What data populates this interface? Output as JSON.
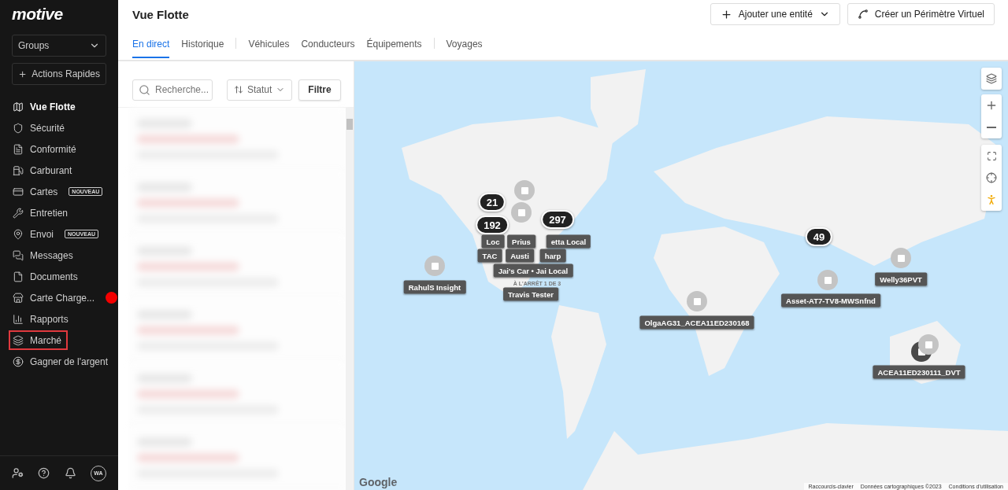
{
  "brand": "motive",
  "sidebar": {
    "groups_select": "Groups",
    "quick_action": "Actions Rapides",
    "items": [
      {
        "label": "Vue Flotte",
        "selected": true,
        "highlighted": false,
        "notification": false
      },
      {
        "label": "Sécurité",
        "selected": false,
        "highlighted": false,
        "notification": false
      },
      {
        "label": "Conformité",
        "selected": false,
        "highlighted": false,
        "notification": false
      },
      {
        "label": "Carburant",
        "selected": false,
        "highlighted": false,
        "notification": false
      },
      {
        "label": "Cartes",
        "badge": "NOUVEAU",
        "selected": false,
        "highlighted": false,
        "notification": false
      },
      {
        "label": "Entretien",
        "selected": false,
        "highlighted": false,
        "notification": false
      },
      {
        "label": "Envoi",
        "badge": "NOUVEAU",
        "selected": false,
        "highlighted": false,
        "notification": false
      },
      {
        "label": "Messages",
        "selected": false,
        "highlighted": false,
        "notification": false
      },
      {
        "label": "Documents",
        "selected": false,
        "highlighted": false,
        "notification": false
      },
      {
        "label": "Carte Charge...",
        "selected": false,
        "highlighted": false,
        "notification": true
      },
      {
        "label": "Rapports",
        "selected": false,
        "highlighted": false,
        "notification": false
      },
      {
        "label": "Marché",
        "selected": false,
        "highlighted": true,
        "notification": false
      },
      {
        "label": "Gagner de l'argent",
        "selected": false,
        "highlighted": false,
        "notification": false
      }
    ],
    "avatar": "WA"
  },
  "header": {
    "title": "Vue Flotte",
    "actions": [
      {
        "label": "Ajouter une entité",
        "kind": "dropdown"
      },
      {
        "label": "Créer un Périmètre Virtuel",
        "kind": "geofence"
      }
    ]
  },
  "tab_groups": [
    {
      "tabs": [
        {
          "label": "En direct",
          "selected": true
        },
        {
          "label": "Historique",
          "selected": false
        }
      ]
    },
    {
      "tabs": [
        {
          "label": "Véhicules",
          "selected": false
        },
        {
          "label": "Conducteurs",
          "selected": false
        },
        {
          "label": "Équipements",
          "selected": false
        }
      ]
    },
    {
      "tabs": [
        {
          "label": "Voyages",
          "selected": false
        }
      ]
    }
  ],
  "list_panel": {
    "search_placeholder": "Recherche...",
    "sort": "Statut",
    "filter": "Filtre"
  },
  "map": {
    "clusters": [
      {
        "count": "21"
      },
      {
        "count": "192"
      },
      {
        "count": "297"
      },
      {
        "count": "49"
      }
    ],
    "labels": [
      {
        "text": "RahulS Insight",
        "kind": "name"
      },
      {
        "text": "Welly36PVT",
        "kind": "name"
      },
      {
        "text": "Asset-AT7-TV8-MWSnfnd",
        "kind": "name"
      },
      {
        "text": "OlgaAG31_ACEA11ED230168",
        "kind": "name"
      },
      {
        "text": "ACEA11ED230111_DVT",
        "kind": "name"
      },
      {
        "text": "Loc",
        "kind": "name"
      },
      {
        "text": "Prius",
        "kind": "name"
      },
      {
        "text": "etta Local",
        "kind": "name"
      },
      {
        "text": "TAC",
        "kind": "name"
      },
      {
        "text": "Austi",
        "kind": "name"
      },
      {
        "text": "harp",
        "kind": "name"
      },
      {
        "text": "Jai's Car • Jai Local",
        "kind": "name"
      },
      {
        "text": "À L'ARRÊT 1 DE 3",
        "kind": "status"
      },
      {
        "text": "Travis Tester",
        "kind": "name"
      }
    ],
    "logo": "Google",
    "attribution": [
      "Raccourcis-clavier",
      "Données cartographiques ©2023",
      "Conditions d'utilisation"
    ]
  }
}
